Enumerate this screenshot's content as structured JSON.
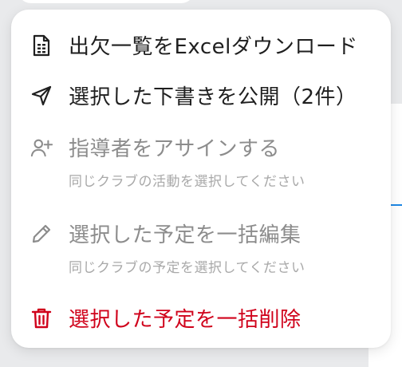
{
  "menu": {
    "items": [
      {
        "label": "出欠一覧をExcelダウンロード",
        "icon": "spreadsheet-file-icon",
        "enabled": true
      },
      {
        "label": "選択した下書きを公開（2件）",
        "icon": "send-icon",
        "enabled": true
      },
      {
        "label": "指導者をアサインする",
        "icon": "add-user-icon",
        "enabled": false,
        "hint": "同じクラブの活動を選択してください"
      },
      {
        "label": "選択した予定を一括編集",
        "icon": "pencil-icon",
        "enabled": false,
        "hint": "同じクラブの予定を選択してください"
      },
      {
        "label": "選択した予定を一括削除",
        "icon": "trash-icon",
        "enabled": true,
        "danger": true
      }
    ]
  },
  "colors": {
    "text": "#1f1f1f",
    "disabled": "#8c8c8c",
    "hint": "#a9a9a9",
    "danger": "#d0021b",
    "accent": "#1e88e5"
  }
}
